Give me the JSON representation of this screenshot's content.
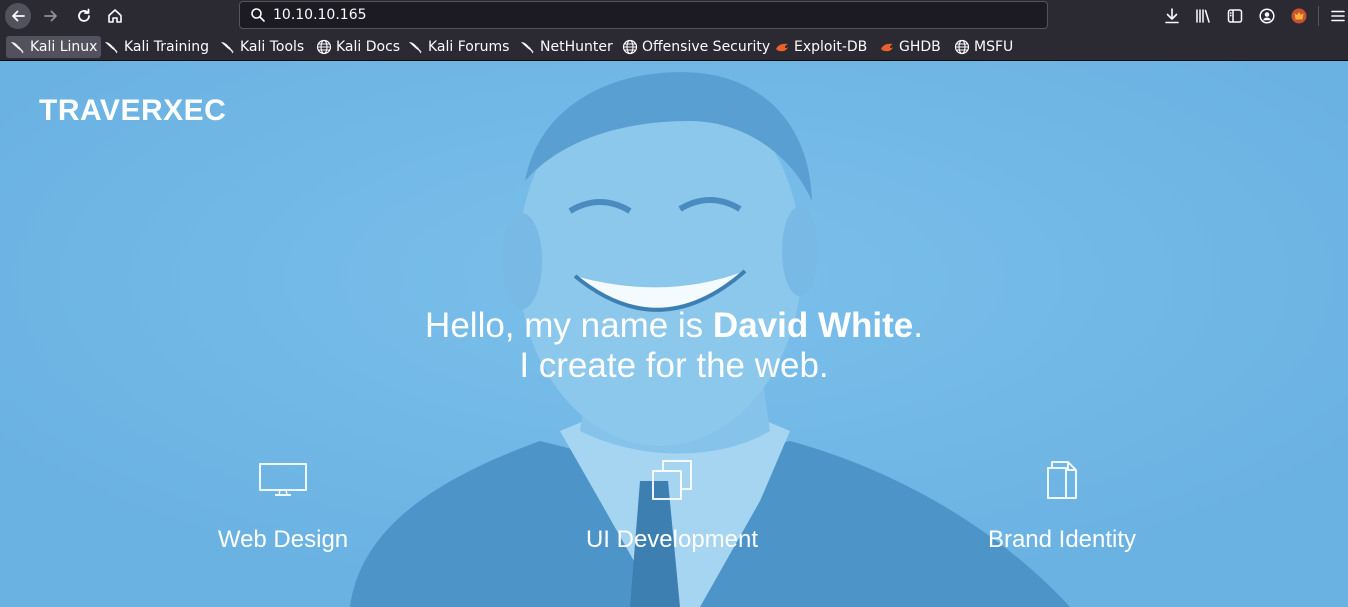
{
  "browser": {
    "url": "10.10.10.165",
    "bookmarks": [
      {
        "label": "Kali Linux",
        "icon": "kali-dragon-icon"
      },
      {
        "label": "Kali Training",
        "icon": "kali-dragon-icon"
      },
      {
        "label": "Kali Tools",
        "icon": "kali-dragon-icon"
      },
      {
        "label": "Kali Docs",
        "icon": "globe-icon"
      },
      {
        "label": "Kali Forums",
        "icon": "kali-dragon-icon"
      },
      {
        "label": "NetHunter",
        "icon": "kali-dragon-icon"
      },
      {
        "label": "Offensive Security",
        "icon": "globe-icon"
      },
      {
        "label": "Exploit-DB",
        "icon": "exploit-db-icon"
      },
      {
        "label": "GHDB",
        "icon": "exploit-db-icon"
      },
      {
        "label": "MSFU",
        "icon": "globe-icon"
      }
    ]
  },
  "site": {
    "brand": "TRAVERXEC",
    "headline": {
      "intro": "Hello, my name is ",
      "name": "David White",
      "end": ".",
      "line2": "I create for the web."
    },
    "services": [
      {
        "label": "Web Design",
        "icon": "monitor-icon"
      },
      {
        "label": "UI Development",
        "icon": "layers-icon"
      },
      {
        "label": "Brand Identity",
        "icon": "document-icon"
      }
    ]
  },
  "colors": {
    "chrome": "#2b2a33",
    "hero_overlay": "#6cb4e4",
    "text": "#ffffff"
  }
}
